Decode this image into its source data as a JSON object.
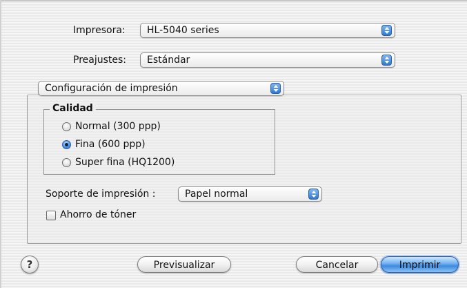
{
  "printer": {
    "label": "Impresora:",
    "value": "HL-5040 series"
  },
  "presets": {
    "label": "Preajustes:",
    "value": "Estándar"
  },
  "section_popup": {
    "value": "Configuración de impresión"
  },
  "quality": {
    "title": "Calidad",
    "options": [
      {
        "label": "Normal (300 ppp)",
        "selected": false
      },
      {
        "label": "Fina (600 ppp)",
        "selected": true
      },
      {
        "label": "Super fina (HQ1200)",
        "selected": false
      }
    ]
  },
  "media": {
    "label": "Soporte de impresión :",
    "value": "Papel normal"
  },
  "toner_save": {
    "label": "Ahorro de tóner",
    "checked": false
  },
  "buttons": {
    "help": "?",
    "preview": "Previsualizar",
    "cancel": "Cancelar",
    "print": "Imprimir"
  },
  "colors": {
    "accent": "#3d8ae0",
    "arrow_button": "#2f78d0"
  }
}
